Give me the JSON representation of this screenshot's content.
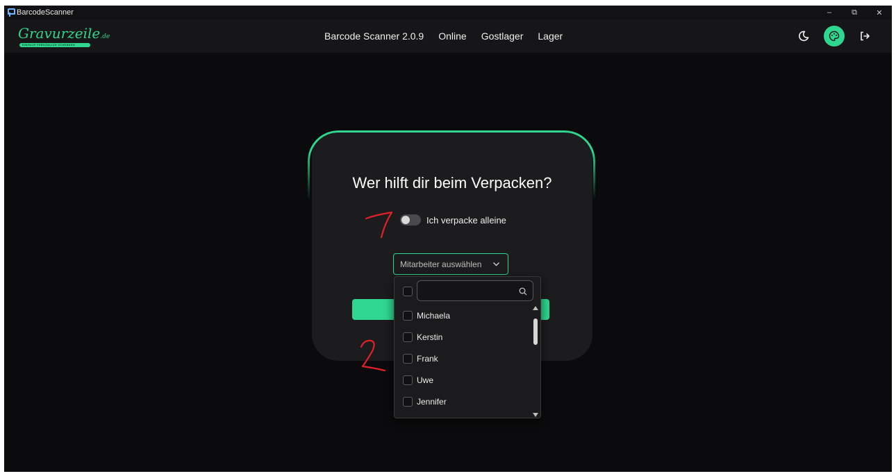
{
  "window": {
    "title": "BarcodeScanner",
    "controls": {
      "minimize": "–",
      "restore": "⧉",
      "close": "✕"
    }
  },
  "navbar": {
    "logo": {
      "text": "Gravurzeile",
      "tld": ".de",
      "tagline": "EINFACH PERSÖNLICH SCHENKEN"
    },
    "links": [
      "Barcode Scanner 2.0.9",
      "Online",
      "Gostlager",
      "Lager"
    ],
    "icons": [
      "moon-icon",
      "palette-icon",
      "logout-icon"
    ]
  },
  "card": {
    "title": "Wer hilft dir beim Verpacken?",
    "toggle": {
      "label": "Ich verpacke alleine",
      "checked": false
    },
    "select": {
      "placeholder": "Mitarbeiter auswählen"
    },
    "dropdown": {
      "search_value": "",
      "items": [
        "Michaela",
        "Kerstin",
        "Frank",
        "Uwe",
        "Jennifer"
      ]
    }
  },
  "annotations": [
    "1",
    "2"
  ],
  "colors": {
    "accent": "#2fd68f",
    "background": "#0b0b0d",
    "card": "#1c1c1e",
    "annotation": "#e0202a"
  }
}
